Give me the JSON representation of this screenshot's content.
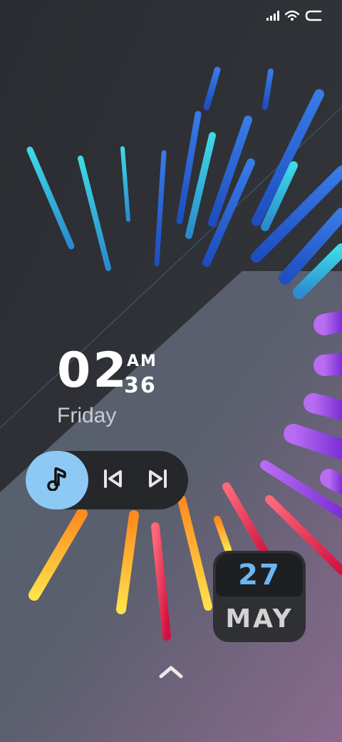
{
  "status_bar": {
    "icons": [
      "signal-icon",
      "wifi-icon",
      "battery-icon"
    ]
  },
  "clock": {
    "hour": "02",
    "minute": "36",
    "ampm": "AM",
    "day": "Friday"
  },
  "music_widget": {
    "icons": [
      "music-note-icon",
      "previous-track-icon",
      "next-track-icon"
    ],
    "accent": "#8ec8f5"
  },
  "date_widget": {
    "day": "27",
    "month": "MAY",
    "day_color": "#6cb6f2"
  },
  "swipe": {
    "icon": "chevron-up-icon"
  }
}
